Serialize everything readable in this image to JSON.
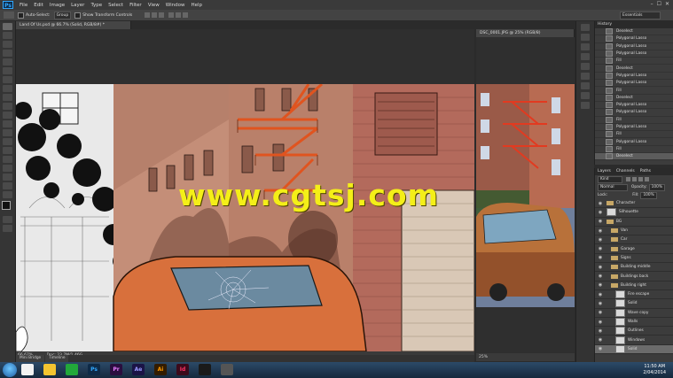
{
  "app": {
    "logo": "Ps",
    "window_controls": [
      "–",
      "☐",
      "✕"
    ]
  },
  "menu": [
    "File",
    "Edit",
    "Image",
    "Layer",
    "Type",
    "Select",
    "Filter",
    "View",
    "Window",
    "Help"
  ],
  "options": {
    "auto_select_label": "Auto-Select:",
    "auto_select_value": "Group",
    "transform_label": "Show Transform Controls",
    "workspace": "Essentials"
  },
  "documents": {
    "main_tab": "Land Of Us.psd @ 66.7% (Solid, RGB/8#) *",
    "main_zoom": "66.67%",
    "main_info": "Doc: 23.7M/1.46G",
    "second_tab": "DSC_0001.JPG @ 25% (RGB/8)",
    "second_zoom": "25%"
  },
  "watermark": "www.cgtsj.com",
  "history": {
    "title": "History",
    "items": [
      "Deselect",
      "Polygonal Lasso",
      "Polygonal Lasso",
      "Polygonal Lasso",
      "Fill",
      "Deselect",
      "Polygonal Lasso",
      "Polygonal Lasso",
      "Fill",
      "Deselect",
      "Polygonal Lasso",
      "Polygonal Lasso",
      "Fill",
      "Polygonal Lasso",
      "Fill",
      "Polygonal Lasso",
      "Fill",
      "Deselect"
    ]
  },
  "layers": {
    "tabs": [
      "Layers",
      "Channels",
      "Paths"
    ],
    "kind_label": "Kind",
    "blend_mode": "Normal",
    "opacity_label": "Opacity:",
    "opacity_value": "100%",
    "lock_label": "Lock:",
    "fill_label": "Fill:",
    "fill_value": "100%",
    "items": [
      {
        "name": "Character",
        "type": "folder",
        "indent": 0
      },
      {
        "name": "Silhouette",
        "type": "layer",
        "indent": 0
      },
      {
        "name": "BG",
        "type": "folder",
        "indent": 0
      },
      {
        "name": "Van",
        "type": "folder",
        "indent": 1
      },
      {
        "name": "Car",
        "type": "folder",
        "indent": 1
      },
      {
        "name": "Garage",
        "type": "folder",
        "indent": 1
      },
      {
        "name": "Signs",
        "type": "folder",
        "indent": 1
      },
      {
        "name": "Building middle",
        "type": "folder",
        "indent": 1
      },
      {
        "name": "Buildings back",
        "type": "folder",
        "indent": 1
      },
      {
        "name": "Building right",
        "type": "folder",
        "indent": 1
      },
      {
        "name": "Fire escape",
        "type": "layer",
        "indent": 2
      },
      {
        "name": "Solid",
        "type": "layer",
        "indent": 2
      },
      {
        "name": "Wave copy",
        "type": "layer",
        "indent": 2
      },
      {
        "name": "Walls",
        "type": "layer",
        "indent": 2
      },
      {
        "name": "Outlines",
        "type": "layer",
        "indent": 2
      },
      {
        "name": "Windows",
        "type": "layer",
        "indent": 2
      },
      {
        "name": "Solid",
        "type": "layer",
        "indent": 2,
        "selected": true
      }
    ]
  },
  "bridge_tabs": [
    "Mini Bridge",
    "Timeline"
  ],
  "taskbar": {
    "apps": [
      {
        "label": "",
        "color": "#e84b3c",
        "bg": "#f2f2f2"
      },
      {
        "label": "",
        "color": "#f4c430",
        "bg": "#f4c430"
      },
      {
        "label": "",
        "color": "#ffffff",
        "bg": "#22a83a"
      },
      {
        "label": "Ps",
        "color": "#31a8ff",
        "bg": "#0e2a47"
      },
      {
        "label": "Pr",
        "color": "#e77cff",
        "bg": "#2a0e3f"
      },
      {
        "label": "Ae",
        "color": "#9999ff",
        "bg": "#1b1446"
      },
      {
        "label": "Ai",
        "color": "#ff9a00",
        "bg": "#331c00"
      },
      {
        "label": "Id",
        "color": "#ff3366",
        "bg": "#3c0a1b"
      },
      {
        "label": "",
        "color": "#1db954",
        "bg": "#1a1a1a"
      },
      {
        "label": "",
        "color": "#ffffff",
        "bg": "#555555"
      }
    ],
    "time": "11:50 AM",
    "date": "2/04/2014"
  }
}
